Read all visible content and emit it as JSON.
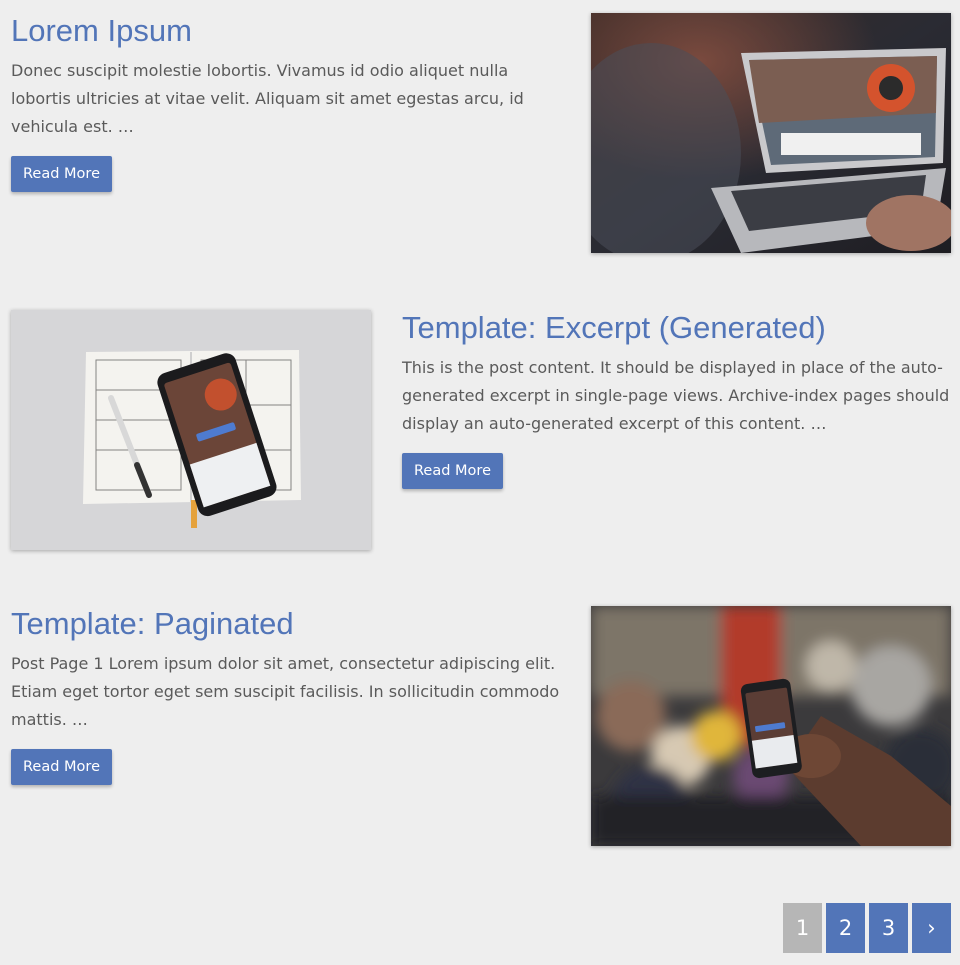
{
  "colors": {
    "accent": "#5275b8",
    "background": "#eeeeee",
    "text": "#5a5a5a",
    "current_page": "#b6b6b6"
  },
  "posts": [
    {
      "title": "Lorem Ipsum",
      "excerpt": "Donec suscipit molestie lobortis. Vivamus id odio aliquet nulla lobortis ultricies at vitae velit. Aliquam sit amet egestas arcu, id vehicula est. …",
      "read_more": "Read More",
      "image": "laptop-photo"
    },
    {
      "title": "Template: Excerpt (Generated)",
      "excerpt": "This is the post content. It should be displayed in place of the auto-generated excerpt in single-page views. Archive-index pages should display an auto-generated excerpt of this content. …",
      "read_more": "Read More",
      "image": "phone-on-notebook-photo"
    },
    {
      "title": "Template: Paginated",
      "excerpt": "Post Page 1 Lorem ipsum dolor sit amet, consectetur adipiscing elit. Etiam eget tortor eget sem suscipit facilisis. In sollicitudin commodo mattis. …",
      "read_more": "Read More",
      "image": "phone-in-hand-photo"
    }
  ],
  "pagination": {
    "pages": [
      "1",
      "2",
      "3"
    ],
    "current": "1",
    "next": "›"
  }
}
